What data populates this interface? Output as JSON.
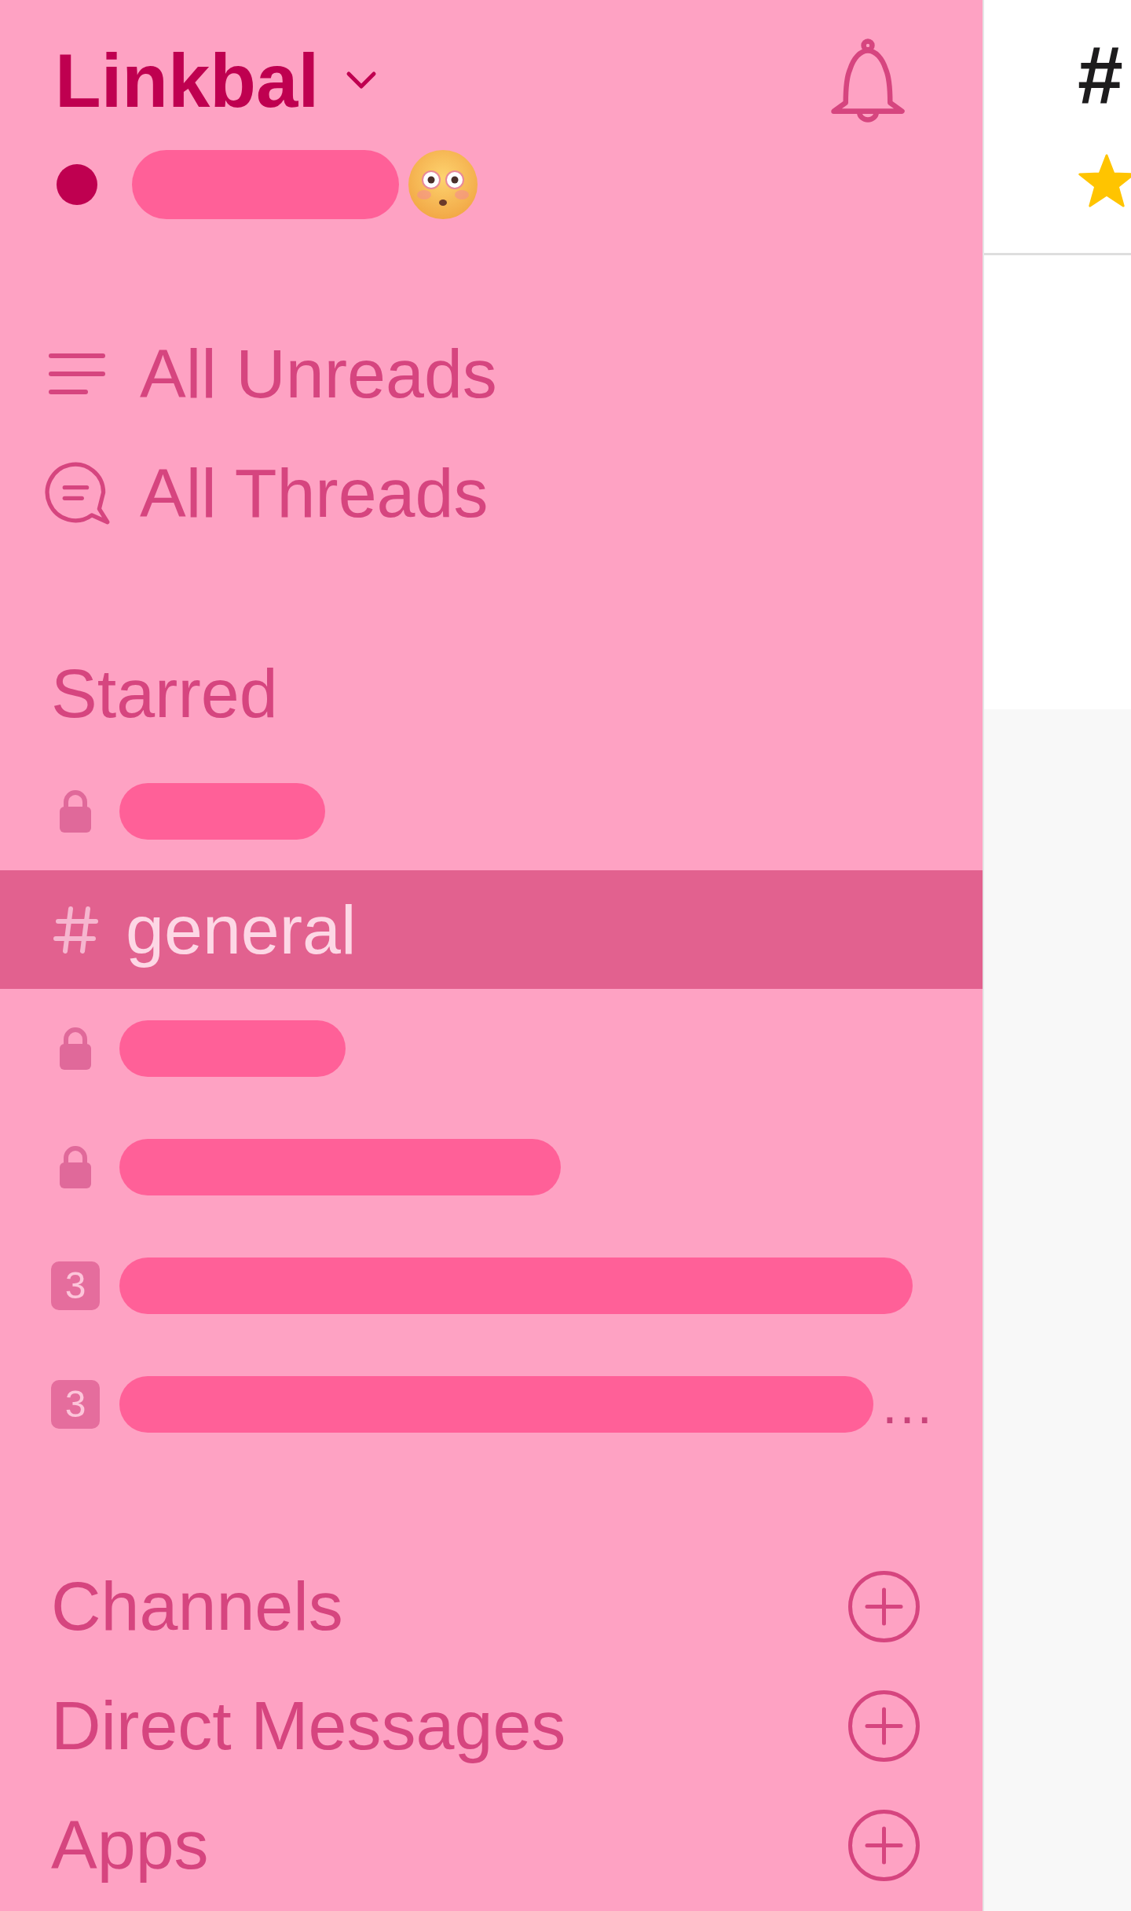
{
  "workspace": {
    "name": "Linkbal"
  },
  "user": {
    "presence_active": true,
    "name_redacted": true
  },
  "nav": [
    {
      "kind": "unreads",
      "label": "All Unreads"
    },
    {
      "kind": "threads",
      "label": "All Threads"
    }
  ],
  "starred": {
    "title": "Starred",
    "items": [
      {
        "kind": "private",
        "redacted": true,
        "selected": false
      },
      {
        "kind": "public",
        "label": "general",
        "redacted": false,
        "selected": true
      },
      {
        "kind": "private",
        "redacted": true,
        "selected": false
      },
      {
        "kind": "private",
        "redacted": true,
        "selected": false
      },
      {
        "kind": "group",
        "member_count": "3",
        "redacted": true,
        "selected": false
      },
      {
        "kind": "group",
        "member_count": "3",
        "redacted": true,
        "label_tail": "…",
        "selected": false
      }
    ]
  },
  "sections": [
    {
      "title": "Channels"
    },
    {
      "title": "Direct Messages"
    },
    {
      "title": "Apps"
    }
  ],
  "channel_header": {
    "title": "#",
    "starred": true
  }
}
